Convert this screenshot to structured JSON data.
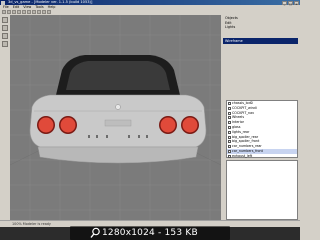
{
  "window": {
    "title": "3d_vs_game - [Modeler ver. 1.1.5 (build 1053)]",
    "controls": [
      "_",
      "□",
      "×"
    ]
  },
  "menu": [
    "File",
    "Edit",
    "View",
    "Tools",
    "Help"
  ],
  "viewport": {
    "label": "Perspective"
  },
  "right_panel": {
    "rows": [
      "Objects",
      "Edit",
      "Lights"
    ],
    "selected_field": "Wireframe"
  },
  "tree": {
    "items": [
      {
        "label": "chassis_lod0",
        "selected": false
      },
      {
        "label": "COCKPIT_windi",
        "selected": false
      },
      {
        "label": "COCKPIT_nav",
        "selected": false
      },
      {
        "label": "Wheels",
        "selected": false
      },
      {
        "label": "Interior",
        "selected": false
      },
      {
        "label": "glass",
        "selected": false
      },
      {
        "label": "lights_rear",
        "selected": false
      },
      {
        "label": "big_spoiler_rear",
        "selected": false
      },
      {
        "label": "big_spoiler_front",
        "selected": false
      },
      {
        "label": "car_numbers_rear",
        "selected": false
      },
      {
        "label": "car_numbers_front",
        "selected": true
      },
      {
        "label": "exhaust_left",
        "selected": false
      }
    ]
  },
  "status": {
    "text": "100% Modeler is ready"
  },
  "overlay": {
    "text": "1280x1024 - 153 KB"
  },
  "colors": {
    "titlebar": "#0a246a",
    "viewport": "#7b7b7b",
    "taillight": "#e04a3a",
    "body": "#c9c9c9"
  }
}
